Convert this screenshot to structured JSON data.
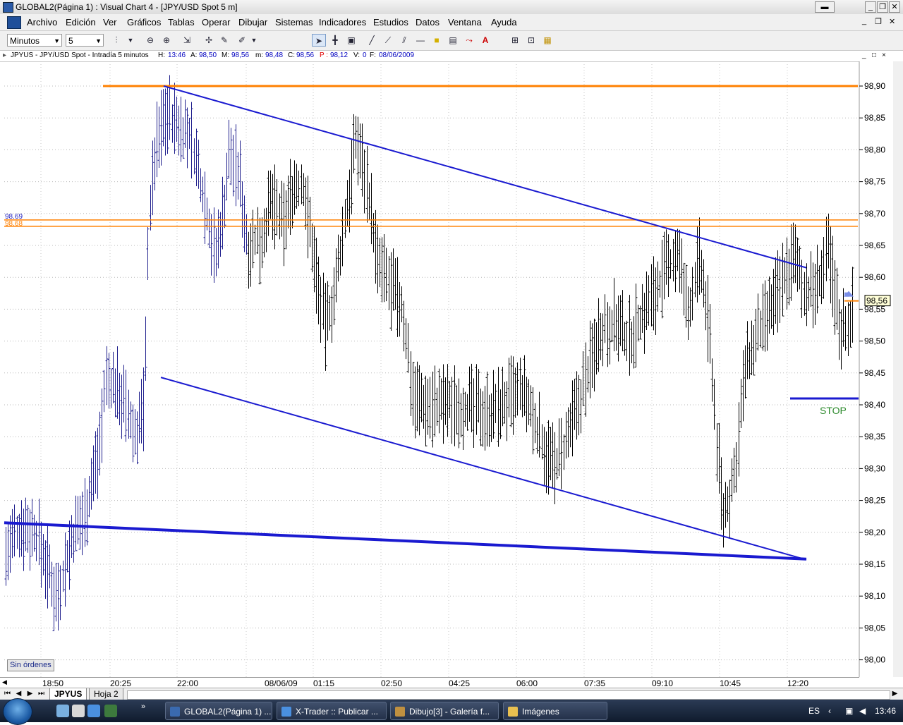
{
  "window": {
    "title": "GLOBAL2(Página 1) : Visual Chart 4 - [JPY/USD Spot 5 m]"
  },
  "menu": [
    "Archivo",
    "Edición",
    "Ver",
    "Gráficos",
    "Tablas",
    "Operar",
    "Dibujar",
    "Sistemas",
    "Indicadores",
    "Estudios",
    "Datos",
    "Ventana",
    "Ayuda"
  ],
  "toolbar": {
    "timeframe": "Minutos",
    "period": "5"
  },
  "chart_header": {
    "symbol": "JPYUS - JPY/USD Spot - Intradía 5 minutos",
    "h_label": "H:",
    "h_value": "13:46",
    "a_label": "A:",
    "a_value": "98,50",
    "m_label": "M:",
    "m_value": "98,56",
    "min_label": "m:",
    "min_value": "98,48",
    "c_label": "C:",
    "c_value": "98,56",
    "p_label": "P :",
    "p_value": "98,12",
    "v_label": "V:",
    "v_value": "0",
    "f_label": "F:",
    "f_value": "08/06/2009"
  },
  "chart_data": {
    "type": "bar",
    "y_ticks": [
      "98,90",
      "98,85",
      "98,80",
      "98,75",
      "98,70",
      "98,65",
      "98,60",
      "98,55",
      "98,50",
      "98,45",
      "98,40",
      "98,35",
      "98,30",
      "98,25",
      "98,20",
      "98,15",
      "98,10",
      "98,05",
      "98,00"
    ],
    "ylim": [
      98.0,
      98.9
    ],
    "x_ticks": [
      "18:50",
      "20:25",
      "22:00",
      "08/06/09",
      "01:15",
      "02:50",
      "04:25",
      "06:00",
      "07:35",
      "09:10",
      "10:45",
      "12:20"
    ],
    "last_price": "98,56",
    "level_labels": {
      "upper": "98.69",
      "lower": "98.68"
    },
    "annotation": "STOP",
    "grid": true
  },
  "status": {
    "orders": "Sin órdenes"
  },
  "sheets": [
    "JPYUS",
    "Hoja 2"
  ],
  "taskbar": {
    "tasks": [
      "GLOBAL2(Página 1) ...",
      "X-Trader :: Publicar ...",
      "Dibujo[3] - Galería f...",
      "Imágenes"
    ],
    "language": "ES",
    "clock": "13:46"
  },
  "colors": {
    "orange": "#ff8000",
    "blue": "#1a1ad0",
    "bars_early": "#1e1e8c",
    "bars_late": "#000000",
    "stop_text": "#2e8b2e"
  }
}
